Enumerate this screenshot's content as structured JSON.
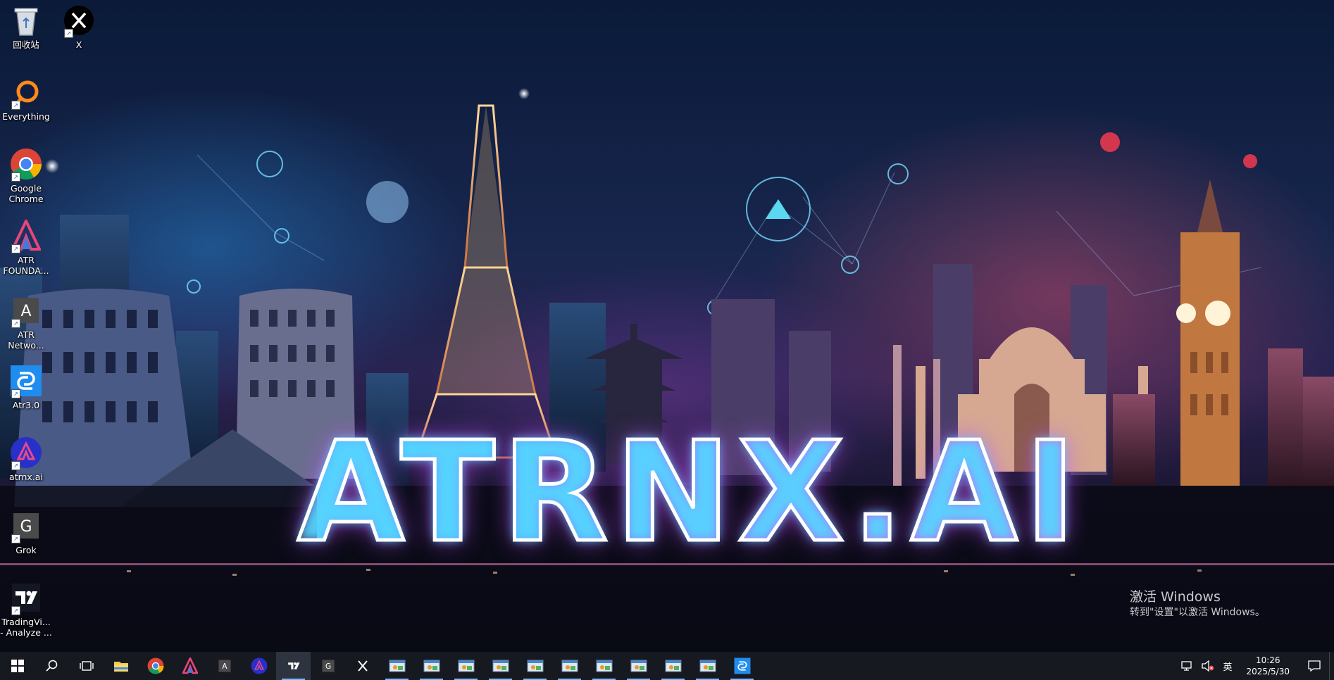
{
  "desktop": {
    "icons": [
      {
        "key": "recycle-bin",
        "label": "回收站"
      },
      {
        "key": "x",
        "label": "X"
      },
      {
        "key": "everything",
        "label": "Everything"
      },
      {
        "key": "google-chrome",
        "label": "Google Chrome"
      },
      {
        "key": "atr-foundation",
        "label": "ATR FOUNDA..."
      },
      {
        "key": "atr-network",
        "label": "ATR Netwo..."
      },
      {
        "key": "atr3",
        "label": "Atr3.0"
      },
      {
        "key": "atrnx",
        "label": "atrnx.ai"
      },
      {
        "key": "grok",
        "label": "Grok"
      },
      {
        "key": "tradingview",
        "label": "TradingVi... - Analyze ..."
      }
    ],
    "wallpaper_text": "ATRNX.AI",
    "activation": {
      "title": "激活 Windows",
      "subtitle": "转到\"设置\"以激活 Windows。"
    }
  },
  "taskbar": {
    "pinned": [
      "start-icon",
      "search-icon",
      "task-view-icon",
      "file-explorer-icon",
      "chrome-icon",
      "atr-foundation-icon",
      "atr-network-icon",
      "atrnx-icon",
      "tradingview-icon",
      "grok-icon",
      "x-icon",
      "app-window-icon",
      "app-window-icon",
      "app-window-icon",
      "app-window-icon",
      "app-window-icon",
      "app-window-icon",
      "app-window-icon",
      "app-window-icon",
      "app-window-icon",
      "app-window-icon",
      "atr3-icon"
    ],
    "tray": {
      "ime": "英",
      "time": "10:26",
      "date": "2025/5/30"
    }
  },
  "colors": {
    "taskbar": "#16191f",
    "running_indicator": "#7db8ff",
    "logo_cyan": "#27e0ff",
    "logo_pink": "#ff4fd2"
  }
}
